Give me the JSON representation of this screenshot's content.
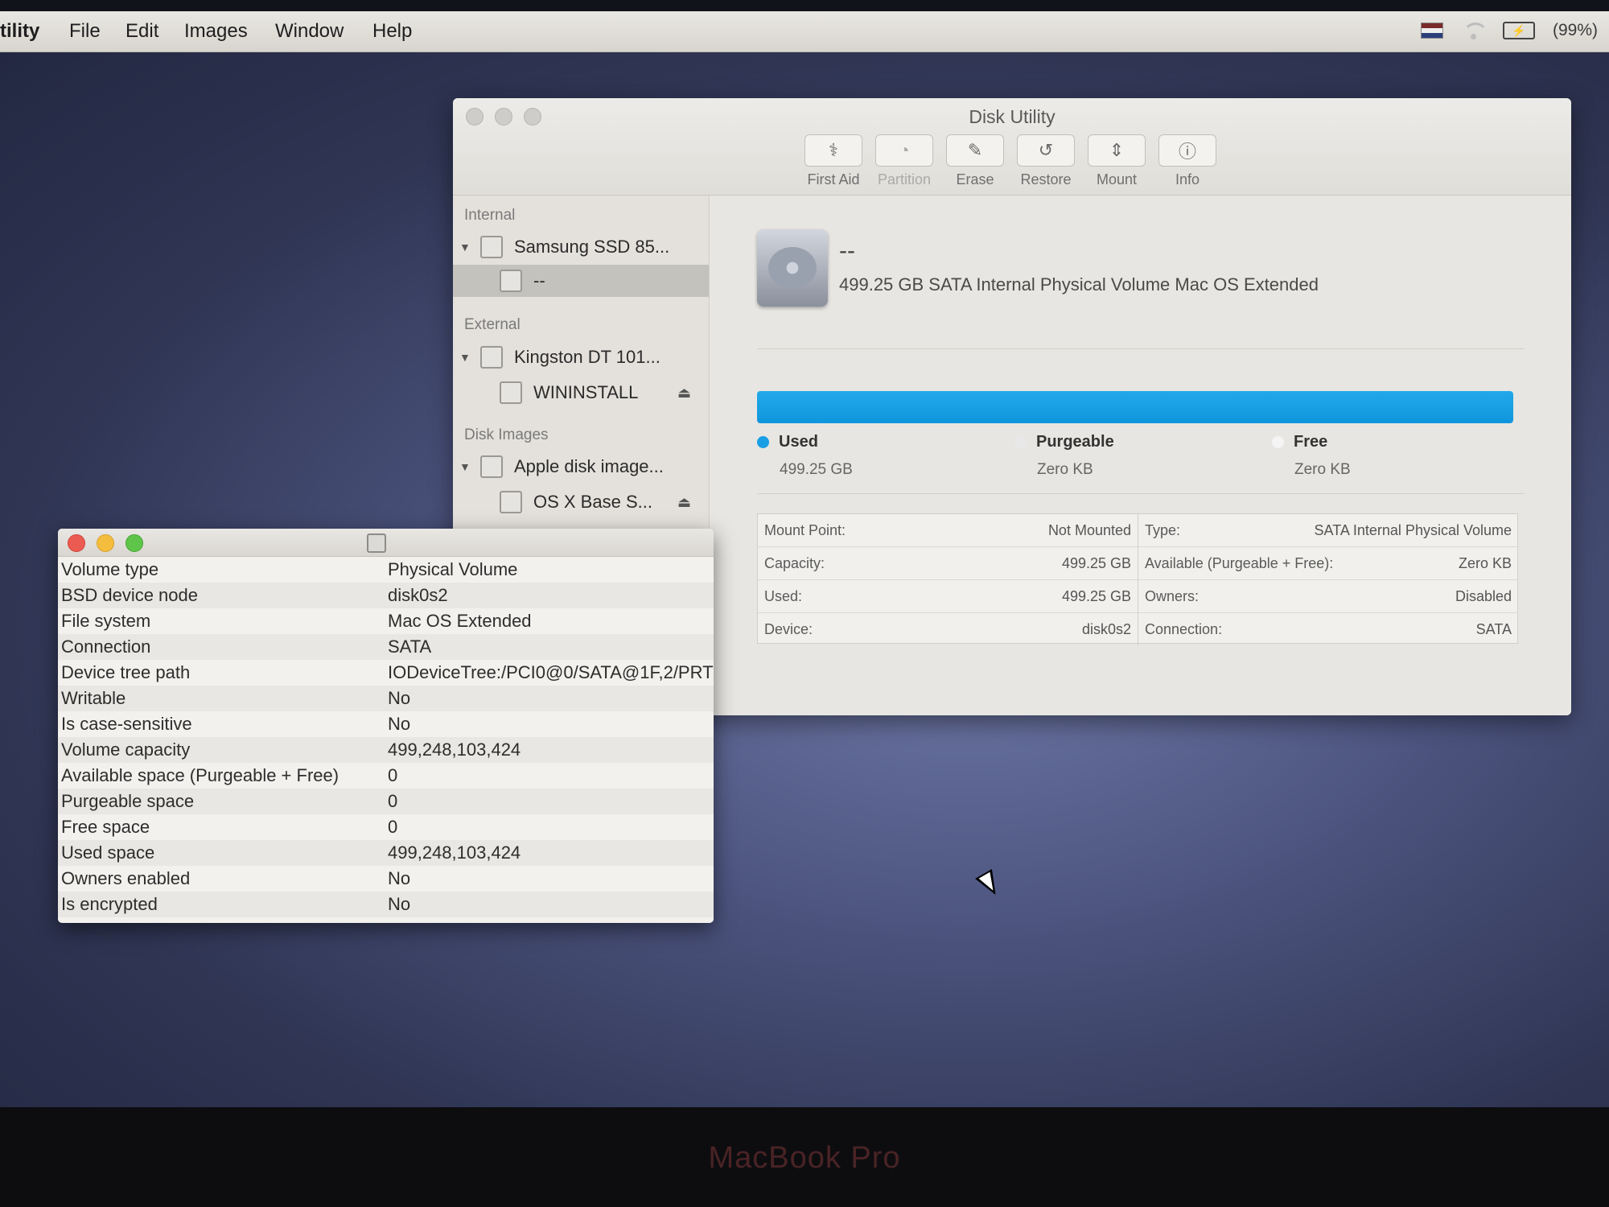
{
  "menubar": {
    "app": "tility",
    "items": [
      "File",
      "Edit",
      "Images",
      "Window",
      "Help"
    ],
    "battery": "(99%)"
  },
  "window": {
    "title": "Disk Utility",
    "toolbar": [
      {
        "label": "First Aid",
        "icon": "stethoscope-icon",
        "enabled": true
      },
      {
        "label": "Partition",
        "icon": "partition-icon",
        "enabled": false
      },
      {
        "label": "Erase",
        "icon": "erase-icon",
        "enabled": true
      },
      {
        "label": "Restore",
        "icon": "restore-icon",
        "enabled": true
      },
      {
        "label": "Mount",
        "icon": "mount-icon",
        "enabled": true
      },
      {
        "label": "Info",
        "icon": "info-icon",
        "enabled": true
      }
    ]
  },
  "sidebar": {
    "internal_label": "Internal",
    "external_label": "External",
    "disk_images_label": "Disk Images",
    "items": [
      {
        "label": "Samsung SSD 85...",
        "level": 0
      },
      {
        "label": "--",
        "level": 1,
        "selected": true
      },
      {
        "label": "Kingston DT 101...",
        "level": 0
      },
      {
        "label": "WININSTALL",
        "level": 1
      },
      {
        "label": "Apple disk image...",
        "level": 0
      },
      {
        "label": "OS X Base S...",
        "level": 1
      }
    ]
  },
  "volume": {
    "name": "--",
    "description": "499.25 GB SATA Internal Physical Volume Mac OS Extended",
    "used_fraction": 1.0,
    "used_color": "#1a9fe4",
    "legend": [
      {
        "name": "Used",
        "value": "499.25 GB",
        "color": "#1a9fe4"
      },
      {
        "name": "Purgeable",
        "value": "Zero KB",
        "color": "#e8e8e8"
      },
      {
        "name": "Free",
        "value": "Zero KB",
        "color": "#f4f4f4"
      }
    ]
  },
  "details": {
    "left": [
      {
        "k": "Mount Point:",
        "v": "Not Mounted"
      },
      {
        "k": "Capacity:",
        "v": "499.25 GB"
      },
      {
        "k": "Used:",
        "v": "499.25 GB"
      },
      {
        "k": "Device:",
        "v": "disk0s2"
      }
    ],
    "right": [
      {
        "k": "Type:",
        "v": "SATA Internal Physical Volume"
      },
      {
        "k": "Available (Purgeable + Free):",
        "v": "Zero KB"
      },
      {
        "k": "Owners:",
        "v": "Disabled"
      },
      {
        "k": "Connection:",
        "v": "SATA"
      }
    ]
  },
  "info_panel": {
    "rows": [
      {
        "k": "Volume type",
        "v": "Physical Volume"
      },
      {
        "k": "BSD device node",
        "v": "disk0s2"
      },
      {
        "k": "File system",
        "v": "Mac OS Extended"
      },
      {
        "k": "Connection",
        "v": "SATA"
      },
      {
        "k": "Device tree path",
        "v": "IODeviceTree:/PCI0@0/SATA@1F,2/PRT"
      },
      {
        "k": "Writable",
        "v": "No"
      },
      {
        "k": "Is case-sensitive",
        "v": "No"
      },
      {
        "k": "Volume capacity",
        "v": "499,248,103,424"
      },
      {
        "k": "Available space (Purgeable + Free)",
        "v": "0"
      },
      {
        "k": "Purgeable space",
        "v": "0"
      },
      {
        "k": "Free space",
        "v": "0"
      },
      {
        "k": "Used space",
        "v": "499,248,103,424"
      },
      {
        "k": "Owners enabled",
        "v": "No"
      },
      {
        "k": "Is encrypted",
        "v": "No"
      }
    ]
  },
  "bezel": {
    "brand": "MacBook Pro"
  }
}
